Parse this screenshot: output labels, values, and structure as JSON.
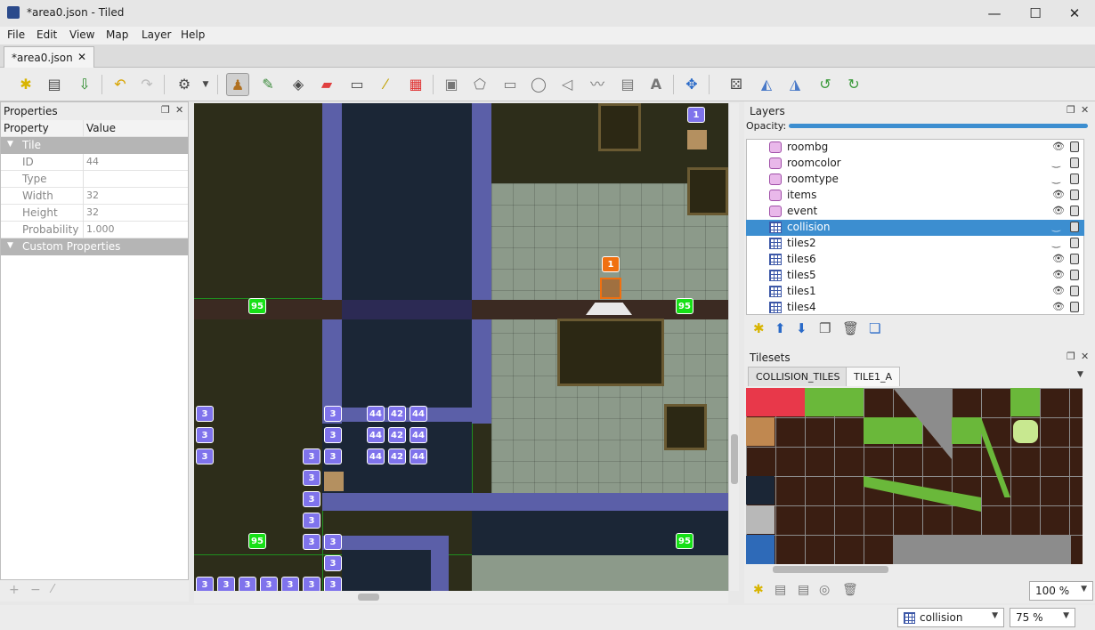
{
  "window": {
    "title": "*area0.json - Tiled",
    "minimize_glyph": "—",
    "maximize_glyph": "☐",
    "close_glyph": "✕"
  },
  "menu": [
    "File",
    "Edit",
    "View",
    "Map",
    "Layer",
    "Help"
  ],
  "document_tab": {
    "label": "*area0.json",
    "close_glyph": "✕"
  },
  "toolbar": {
    "tools": [
      "new-map-icon",
      "open-icon",
      "save-icon",
      "undo-icon",
      "redo-icon",
      "command-gear-icon",
      "stamp-brush-icon",
      "terrain-brush-icon",
      "bucket-fill-icon",
      "eraser-icon",
      "rectangular-select-icon",
      "magic-wand-icon",
      "select-same-tile-icon",
      "object-select-icon",
      "edit-polygons-icon",
      "insert-rectangle-icon",
      "insert-ellipse-icon",
      "insert-polygon-icon",
      "insert-polyline-icon",
      "insert-tile-icon",
      "insert-text-icon",
      "move-icon",
      "random-mode-icon",
      "flip-horizontal-icon",
      "flip-vertical-icon",
      "rotate-left-icon",
      "rotate-right-icon"
    ]
  },
  "properties": {
    "title": "Properties",
    "col_property": "Property",
    "col_value": "Value",
    "section_tile": "Tile",
    "section_custom": "Custom Properties",
    "rows": [
      {
        "key": "ID",
        "value": "44"
      },
      {
        "key": "Type",
        "value": ""
      },
      {
        "key": "Width",
        "value": "32"
      },
      {
        "key": "Height",
        "value": "32"
      },
      {
        "key": "Probability",
        "value": "1.000"
      }
    ]
  },
  "map_labels": {
    "three": "3",
    "ninetyfive": "95",
    "one": "1",
    "fortyfour": "44",
    "fortytwo": "42"
  },
  "layers": {
    "title": "Layers",
    "opacity_label": "Opacity:",
    "opacity": 1.0,
    "items": [
      {
        "name": "roombg",
        "type": "group",
        "visible": true
      },
      {
        "name": "roomcolor",
        "type": "group",
        "visible": false
      },
      {
        "name": "roomtype",
        "type": "group",
        "visible": false
      },
      {
        "name": "items",
        "type": "group",
        "visible": true
      },
      {
        "name": "event",
        "type": "group",
        "visible": true
      },
      {
        "name": "collision",
        "type": "tile",
        "visible": false,
        "selected": true
      },
      {
        "name": "tiles2",
        "type": "tile",
        "visible": false
      },
      {
        "name": "tiles6",
        "type": "tile",
        "visible": true
      },
      {
        "name": "tiles5",
        "type": "tile",
        "visible": true
      },
      {
        "name": "tiles1",
        "type": "tile",
        "visible": true
      },
      {
        "name": "tiles4",
        "type": "tile",
        "visible": true
      }
    ]
  },
  "tilesets": {
    "title": "Tilesets",
    "tabs": [
      "COLLISION_TILES",
      "TILE1_A"
    ],
    "zoom": "100 %"
  },
  "status": {
    "layer": "collision",
    "zoom": "75 %"
  },
  "colors": {
    "selection": "#3c8ed0",
    "accent_green": "#16e016",
    "tile_purple": "#7f73ec"
  }
}
